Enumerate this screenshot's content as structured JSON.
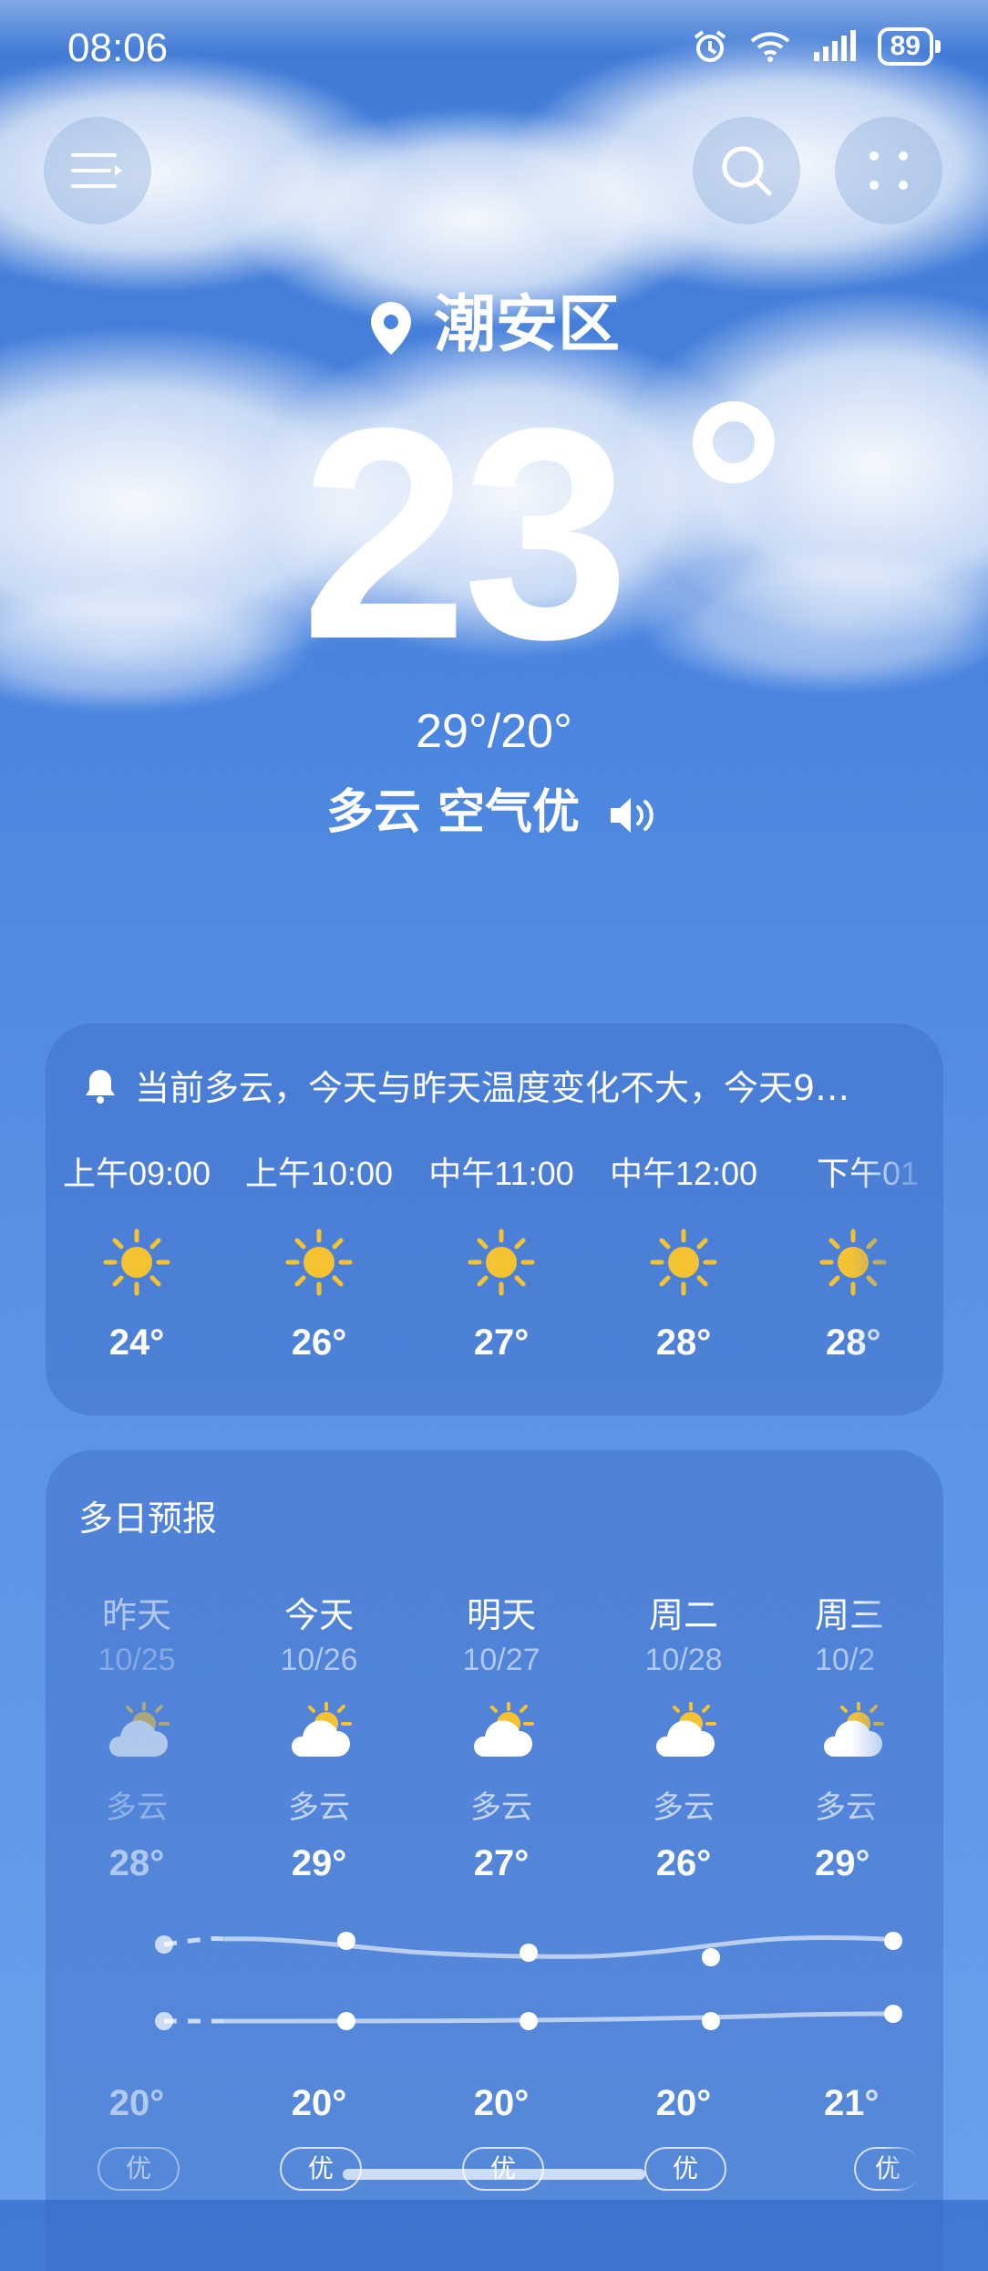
{
  "status_bar": {
    "time": "08:06",
    "battery": "89"
  },
  "header": {
    "location": "潮安区",
    "temperature": "23",
    "high_low": "29°/20°",
    "condition": "多云 空气优"
  },
  "hourly_card": {
    "alert": "当前多云，今天与昨天温度变化不大，今天9…",
    "hours": [
      {
        "time": "上午09:00",
        "temp": "24°"
      },
      {
        "time": "上午10:00",
        "temp": "26°"
      },
      {
        "time": "中午11:00",
        "temp": "27°"
      },
      {
        "time": "中午12:00",
        "temp": "28°"
      },
      {
        "time": "下午01",
        "temp": "28°"
      }
    ]
  },
  "daily_card": {
    "title": "多日预报",
    "days": [
      {
        "name": "昨天",
        "date": "10/25",
        "weather": "多云",
        "high": "28°",
        "low": "20°",
        "aqi": "优"
      },
      {
        "name": "今天",
        "date": "10/26",
        "weather": "多云",
        "high": "29°",
        "low": "20°",
        "aqi": "优"
      },
      {
        "name": "明天",
        "date": "10/27",
        "weather": "多云",
        "high": "27°",
        "low": "20°",
        "aqi": "优"
      },
      {
        "name": "周二",
        "date": "10/28",
        "weather": "多云",
        "high": "26°",
        "low": "20°",
        "aqi": "优"
      },
      {
        "name": "周三",
        "date": "10/2",
        "weather": "多云",
        "high": "29°",
        "low": "21°",
        "aqi": "优"
      }
    ]
  },
  "colors": {
    "sun": "#f5c331",
    "card": "#3c69c3",
    "sky": "#4a84df"
  }
}
